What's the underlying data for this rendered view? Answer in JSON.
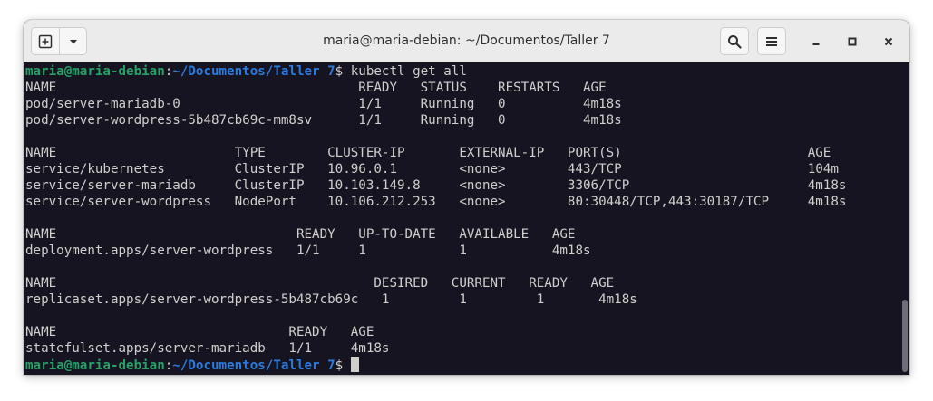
{
  "window": {
    "title": "maria@maria-debian: ~/Documentos/Taller 7"
  },
  "toolbar": {
    "new_tab_icon": "new-tab-icon",
    "menu_chevron_icon": "chevron-down-icon",
    "search_icon": "search-icon",
    "hamburger_icon": "hamburger-menu-icon",
    "minimize_icon": "minimize-icon",
    "maximize_icon": "maximize-icon",
    "close_icon": "close-icon"
  },
  "prompt": {
    "user_host": "maria@maria-debian",
    "sep": ":",
    "path": "~/Documentos/Taller 7",
    "sym": "$ "
  },
  "command": "kubectl get all",
  "output_lines": [
    "NAME                                       READY   STATUS    RESTARTS   AGE",
    "pod/server-mariadb-0                       1/1     Running   0          4m18s",
    "pod/server-wordpress-5b487cb69c-mm8sv      1/1     Running   0          4m18s",
    "",
    "NAME                       TYPE        CLUSTER-IP       EXTERNAL-IP   PORT(S)                        AGE",
    "service/kubernetes         ClusterIP   10.96.0.1        <none>        443/TCP                        104m",
    "service/server-mariadb     ClusterIP   10.103.149.8     <none>        3306/TCP                       4m18s",
    "service/server-wordpress   NodePort    10.106.212.253   <none>        80:30448/TCP,443:30187/TCP     4m18s",
    "",
    "NAME                               READY   UP-TO-DATE   AVAILABLE   AGE",
    "deployment.apps/server-wordpress   1/1     1            1           4m18s",
    "",
    "NAME                                         DESIRED   CURRENT   READY   AGE",
    "replicaset.apps/server-wordpress-5b487cb69c   1         1         1       4m18s",
    "",
    "NAME                              READY   AGE",
    "statefulset.apps/server-mariadb   1/1     4m18s"
  ],
  "colors": {
    "terminal_bg": "#171421",
    "terminal_fg": "#d0cfcc",
    "prompt_user": "#26a269",
    "prompt_path": "#2a7bde",
    "titlebar_bg": "#ebebeb"
  }
}
